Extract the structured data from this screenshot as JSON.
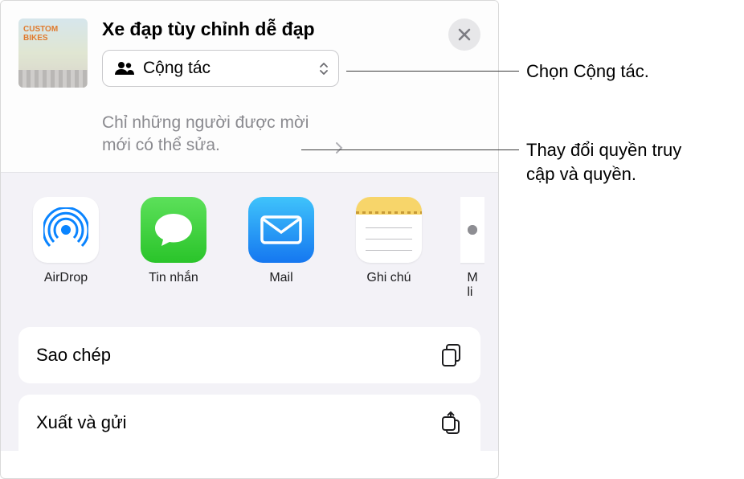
{
  "doc": {
    "title": "Xe đạp tùy chỉnh dễ đạp",
    "collab_label": "Cộng tác",
    "permission_text": "Chỉ những người được mời mới có thể sửa."
  },
  "apps": [
    {
      "id": "airdrop",
      "label": "AirDrop"
    },
    {
      "id": "messages",
      "label": "Tin nhắn"
    },
    {
      "id": "mail",
      "label": "Mail"
    },
    {
      "id": "notes",
      "label": "Ghi chú"
    },
    {
      "id": "more",
      "label": "Mời liên kết"
    }
  ],
  "actions": {
    "copy": "Sao chép",
    "export": "Xuất và gửi"
  },
  "callouts": {
    "collab": "Chọn Cộng tác.",
    "permission": "Thay đổi quyền truy cập và quyền."
  },
  "colors": {
    "panel_bg": "#f3f2f7",
    "text_secondary": "#8a8a8f"
  }
}
